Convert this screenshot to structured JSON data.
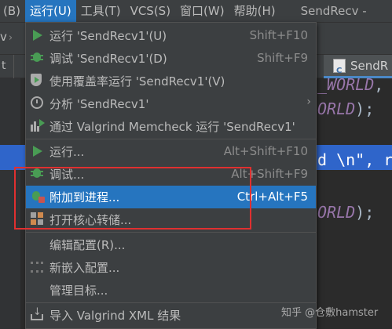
{
  "menubar": {
    "items": [
      "(B)",
      "运行(U)",
      "工具(T)",
      "VCS(S)",
      "窗口(W)",
      "帮助(H)"
    ],
    "window_title": "SendRecv -"
  },
  "navbar": {
    "crumb": "v"
  },
  "tabs": {
    "left_fragment": "t",
    "right_tab": "SendR",
    "right_tab_icon": "C"
  },
  "editor": {
    "lines": [
      {
        "const": "_WORLD",
        "rest": ","
      },
      {
        "const": "ORLD",
        "rest": ");"
      },
      {
        "str": "d \\n\"",
        "rest": ", ra"
      },
      {
        "const": "ORLD",
        "rest": ");"
      }
    ]
  },
  "menu": {
    "items": [
      {
        "icon": "run-icon",
        "label": "运行 'SendRecv1'(U)",
        "shortcut": "Shift+F10"
      },
      {
        "icon": "debug-icon",
        "label": "调试 'SendRecv1'(D)",
        "shortcut": "Shift+F9"
      },
      {
        "icon": "coverage-icon",
        "label": "使用覆盖率运行  'SendRecv1'(V)",
        "shortcut": ""
      },
      {
        "icon": "profile-icon",
        "label": "分析 'SendRecv1'",
        "shortcut": ""
      },
      {
        "icon": "valgrind-icon",
        "label": "通过 Valgrind Memcheck 运行 'SendRecv1'",
        "shortcut": ""
      },
      {
        "icon": "run-icon",
        "label": "运行...",
        "shortcut": "Alt+Shift+F10"
      },
      {
        "icon": "debug-icon",
        "label": "调试...",
        "shortcut": "Alt+Shift+F9"
      },
      {
        "icon": "attach-process-icon",
        "label": "附加到进程...",
        "shortcut": "Ctrl+Alt+F5"
      },
      {
        "icon": "core-dump-icon",
        "label": "打开核心转储...",
        "shortcut": ""
      },
      {
        "icon": "",
        "label": "编辑配置(R)...",
        "shortcut": ""
      },
      {
        "icon": "embedded-config-icon",
        "label": "新嵌入配置...",
        "shortcut": ""
      },
      {
        "icon": "",
        "label": "管理目标...",
        "shortcut": ""
      },
      {
        "icon": "import-icon",
        "label": "导入 Valgrind XML 结果",
        "shortcut": ""
      }
    ],
    "selected_label": "附加到进程..."
  },
  "watermark": "知乎 @仓敷hamster",
  "colors": {
    "accent": "#2675bf",
    "annotation": "#e03030",
    "run_green": "#499c54"
  }
}
